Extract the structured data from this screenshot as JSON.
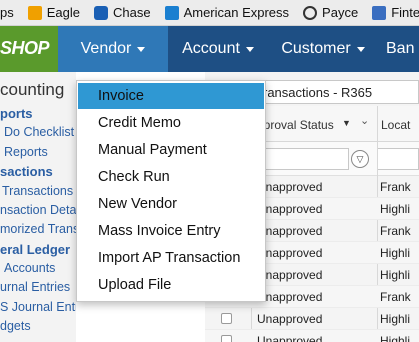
{
  "bookmarks": [
    {
      "label": "ps",
      "icon": "apps-icon",
      "color": "#5b8ad6"
    },
    {
      "label": "Eagle",
      "icon": "eagle-icon",
      "color": "#f0a000"
    },
    {
      "label": "Chase",
      "icon": "chase-icon",
      "color": "#1a5fb4"
    },
    {
      "label": "American Express",
      "icon": "amex-icon",
      "color": "#1a7fd0"
    },
    {
      "label": "Payce",
      "icon": "payce-icon",
      "color": "#333333"
    },
    {
      "label": "Fintec",
      "icon": "fintech-icon",
      "color": "#3a6ec0"
    }
  ],
  "logo": {
    "text": "SHOP",
    "color": "#5a9a2c"
  },
  "nav": {
    "bg": "#1e4f84",
    "active_bg": "#2f78b7",
    "items": [
      {
        "label": "Vendor"
      },
      {
        "label": "Account"
      },
      {
        "label": "Customer"
      },
      {
        "label": "Ban"
      }
    ]
  },
  "sidebar": {
    "title": "counting",
    "items": [
      {
        "label": "ports",
        "bold": true
      },
      {
        "label": "Do Checklist",
        "bold": false
      },
      {
        "label": "Reports",
        "bold": false
      },
      {
        "label": "sactions",
        "bold": true
      },
      {
        "label": "Transactions",
        "bold": false
      },
      {
        "label": "nsaction Deta",
        "bold": false
      },
      {
        "label": "morized Trans",
        "bold": false
      },
      {
        "label": "eral Ledger",
        "bold": true
      },
      {
        "label": "Accounts",
        "bold": false
      },
      {
        "label": "urnal Entries",
        "bold": false
      },
      {
        "label": "S Journal Entries",
        "bold": false
      },
      {
        "label": "dgets",
        "bold": false
      }
    ]
  },
  "content": {
    "breadcrumb": "ransactions - R365",
    "columns": [
      {
        "label": "pproval Status"
      },
      {
        "label": "Locat"
      }
    ],
    "rows": [
      {
        "status": "Unapproved",
        "location": "Frank"
      },
      {
        "status": "Unapproved",
        "location": "Highli"
      },
      {
        "status": "Unapproved",
        "location": "Frank"
      },
      {
        "status": "Unapproved",
        "location": "Highli"
      },
      {
        "status": "Unapproved",
        "location": "Highli"
      },
      {
        "status": "Unapproved",
        "location": "Frank"
      },
      {
        "status": "Unapproved",
        "location": "Highli"
      },
      {
        "status": "Unapproved",
        "location": "Highli"
      },
      {
        "status": "Unapproved",
        "location": "Highli"
      }
    ]
  },
  "dropdown": {
    "highlight_color": "#2f98d3",
    "items": [
      {
        "label": "Invoice"
      },
      {
        "label": "Credit Memo"
      },
      {
        "label": "Manual Payment"
      },
      {
        "label": "Check Run"
      },
      {
        "label": "New Vendor"
      },
      {
        "label": "Mass Invoice Entry"
      },
      {
        "label": "Import AP Transaction"
      },
      {
        "label": "Upload File"
      }
    ]
  }
}
